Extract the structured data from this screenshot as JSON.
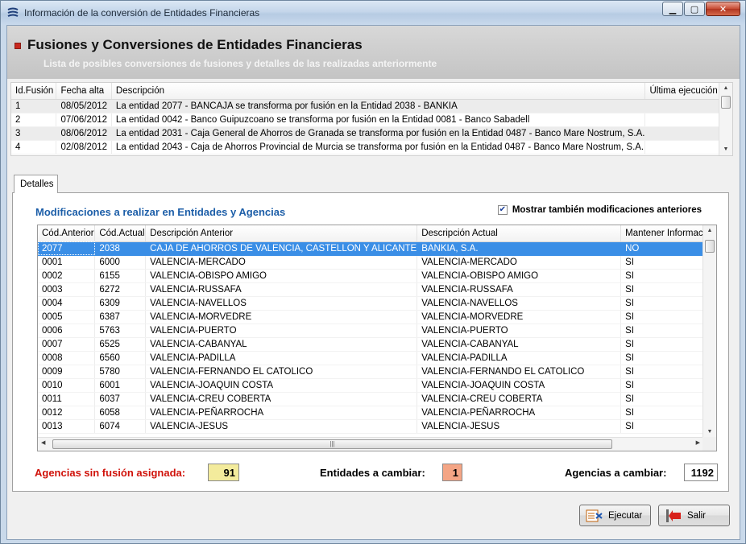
{
  "window": {
    "title": "Información de la conversión de Entidades Financieras",
    "controls": {
      "minimize": "▁",
      "maximize": "▢",
      "close": "✕"
    }
  },
  "header": {
    "title": "Fusiones y Conversiones de Entidades Financieras",
    "subtitle": "Lista de posibles conversiones de fusiones  y detalles de las realizadas anteriormente"
  },
  "fusions_grid": {
    "columns": [
      "Id.Fusión",
      "Fecha alta",
      "Descripción",
      "Última ejecución"
    ],
    "rows": [
      [
        "1",
        "08/05/2012",
        "La entidad 2077 - BANCAJA se transforma por fusión en la Entidad 2038 - BANKIA",
        ""
      ],
      [
        "2",
        "07/06/2012",
        "La entidad 0042 - Banco Guipuzcoano se transforma por fusión en la Entidad 0081 - Banco Sabadell",
        ""
      ],
      [
        "3",
        "08/06/2012",
        "La entidad 2031 - Caja General de Ahorros de Granada se transforma por fusión en la Entidad 0487 - Banco Mare Nostrum, S.A.",
        ""
      ],
      [
        "4",
        "02/08/2012",
        "La entidad 2043 - Caja de Ahorros Provincial de Murcia se transforma por fusión en la Entidad 0487 - Banco Mare Nostrum, S.A.",
        ""
      ]
    ]
  },
  "tabs": {
    "detalles": "Detalles"
  },
  "details": {
    "section_title": "Modificaciones a realizar en Entidades y Agencias",
    "show_previous_label": "Mostrar también modificaciones anteriores",
    "show_previous_checked": true,
    "columns": [
      "Cód.Anterior",
      "Cód.Actual",
      "Descripción Anterior",
      "Descripción Actual",
      "Mantener Información"
    ],
    "rows": [
      [
        "2077",
        "2038",
        "CAJA DE AHORROS DE VALENCIA, CASTELLON Y ALICANTE",
        "BANKIA, S.A.",
        "NO"
      ],
      [
        "0001",
        "6000",
        "VALENCIA-MERCADO",
        "VALENCIA-MERCADO",
        "SI"
      ],
      [
        "0002",
        "6155",
        "VALENCIA-OBISPO AMIGO",
        "VALENCIA-OBISPO AMIGO",
        "SI"
      ],
      [
        "0003",
        "6272",
        "VALENCIA-RUSSAFA",
        "VALENCIA-RUSSAFA",
        "SI"
      ],
      [
        "0004",
        "6309",
        "VALENCIA-NAVELLOS",
        "VALENCIA-NAVELLOS",
        "SI"
      ],
      [
        "0005",
        "6387",
        "VALENCIA-MORVEDRE",
        "VALENCIA-MORVEDRE",
        "SI"
      ],
      [
        "0006",
        "5763",
        "VALENCIA-PUERTO",
        "VALENCIA-PUERTO",
        "SI"
      ],
      [
        "0007",
        "6525",
        "VALENCIA-CABANYAL",
        "VALENCIA-CABANYAL",
        "SI"
      ],
      [
        "0008",
        "6560",
        "VALENCIA-PADILLA",
        "VALENCIA-PADILLA",
        "SI"
      ],
      [
        "0009",
        "5780",
        "VALENCIA-FERNANDO EL CATOLICO",
        "VALENCIA-FERNANDO EL CATOLICO",
        "SI"
      ],
      [
        "0010",
        "6001",
        "VALENCIA-JOAQUIN COSTA",
        "VALENCIA-JOAQUIN COSTA",
        "SI"
      ],
      [
        "0011",
        "6037",
        "VALENCIA-CREU COBERTA",
        "VALENCIA-CREU COBERTA",
        "SI"
      ],
      [
        "0012",
        "6058",
        "VALENCIA-PEÑARROCHA",
        "VALENCIA-PEÑARROCHA",
        "SI"
      ],
      [
        "0013",
        "6074",
        "VALENCIA-JESUS",
        "VALENCIA-JESUS",
        "SI"
      ]
    ]
  },
  "stats": {
    "agencias_sin_fusion_label": "Agencias sin fusión asignada:",
    "agencias_sin_fusion_value": "91",
    "entidades_cambiar_label": "Entidades a cambiar:",
    "entidades_cambiar_value": "1",
    "agencias_cambiar_label": "Agencias a cambiar:",
    "agencias_cambiar_value": "1192"
  },
  "buttons": {
    "ejecutar": "Ejecutar",
    "salir": "Salir"
  },
  "colors": {
    "section_title": "#1c5ea8",
    "stat_red": "#d0120a",
    "stat_yellow_box": "#f3eb9c",
    "stat_orange_box": "#f4a585",
    "selection": "#3a8ee6"
  }
}
